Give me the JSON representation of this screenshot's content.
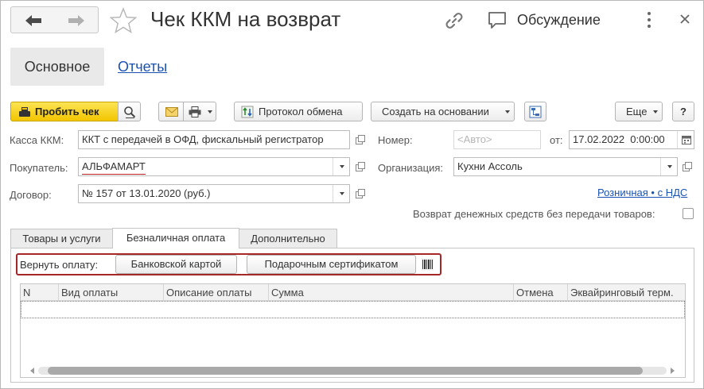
{
  "window": {
    "title": "Чек ККМ на возврат",
    "discussion_label": "Обсуждение"
  },
  "sections": {
    "main": "Основное",
    "reports": "Отчеты"
  },
  "toolbar": {
    "print_check": "Пробить чек",
    "exchange_log": "Протокол обмена",
    "create_based_on": "Создать на основании",
    "more": "Еще",
    "help": "?"
  },
  "form": {
    "kassa_label": "Касса ККМ:",
    "kassa_value": "ККТ с передачей в ОФД, фискальный регистратор",
    "buyer_label": "Покупатель:",
    "buyer_value": "АЛЬФАМАРТ",
    "contract_label": "Договор:",
    "contract_value": "№ 157 от 13.01.2020 (руб.)",
    "number_label": "Номер:",
    "number_placeholder": "<Авто>",
    "date_label": "от:",
    "date_value": "17.02.2022  0:00:00",
    "org_label": "Организация:",
    "org_value": "Кухни Ассоль",
    "price_link": "Розничная • с НДС",
    "refund_label": "Возврат денежных средств без передачи товаров:"
  },
  "tabs": [
    {
      "label": "Товары и услуги"
    },
    {
      "label": "Безналичная оплата"
    },
    {
      "label": "Дополнительно"
    }
  ],
  "payment": {
    "return_label": "Вернуть оплату:",
    "bank_card": "Банковской картой",
    "gift_cert": "Подарочным сертификатом"
  },
  "table": {
    "columns": [
      "N",
      "Вид оплаты",
      "Описание оплаты",
      "Сумма",
      "Отмена",
      "Эквайринговый терм."
    ]
  },
  "colors": {
    "accent_yellow": "#f2c500",
    "link_blue": "#1a52b3",
    "highlight_red": "#a52727"
  }
}
